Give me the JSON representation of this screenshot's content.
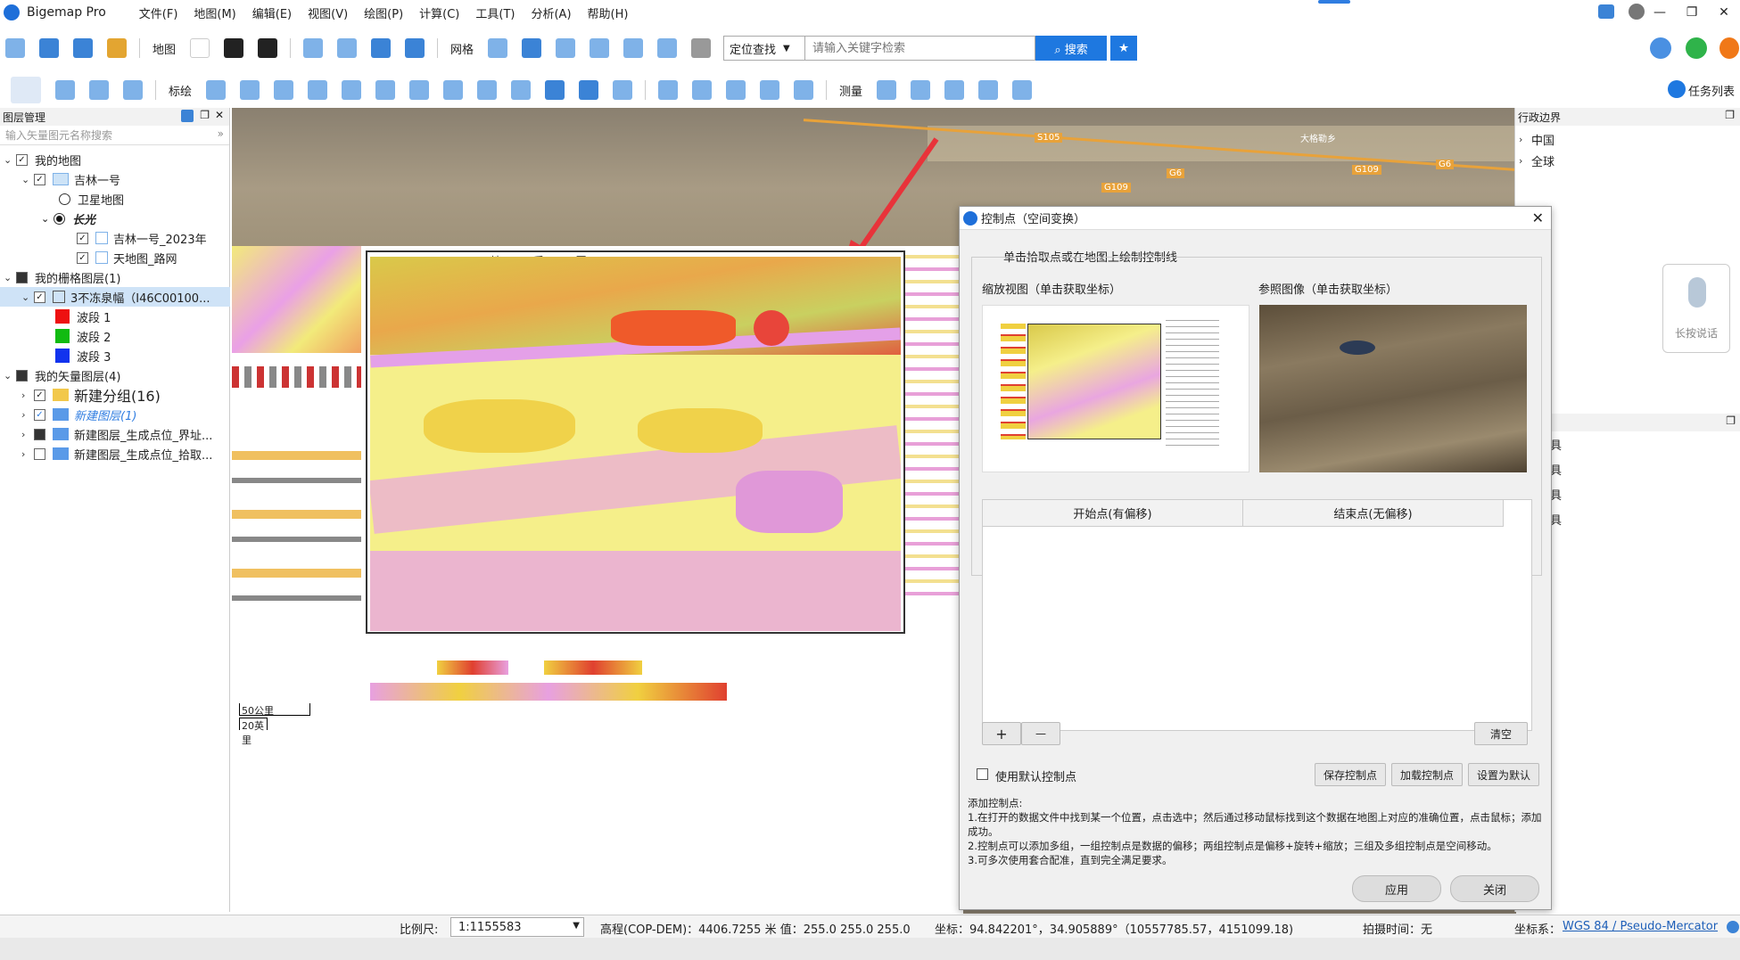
{
  "app": {
    "title": "Bigemap Pro",
    "menus": [
      "文件(F)",
      "地图(M)",
      "编辑(E)",
      "视图(V)",
      "绘图(P)",
      "计算(C)",
      "工具(T)",
      "分析(A)",
      "帮助(H)"
    ],
    "window_controls": [
      "—",
      "❐",
      "✕"
    ]
  },
  "toolbar1": {
    "map_label": "地图",
    "grid_label": "网格",
    "locate_select": "定位查找",
    "search_placeholder": "请输入关键字检索",
    "search_button": "搜索"
  },
  "toolbar2": {
    "mark_label": "标绘",
    "measure_label": "测量",
    "tasklist_label": "任务列表"
  },
  "layer_panel": {
    "title": "图层管理",
    "filter_placeholder": "输入矢量图元名称搜索",
    "my_map": "我的地图",
    "jilin1": "吉林一号",
    "satellite": "卫星地图",
    "changguang": "长光",
    "jilin_2023": "吉林一号_2023年",
    "tianditu": "天地图_路网",
    "raster_layers": "我的栅格图层(1)",
    "raster_item": "3不冻泉幅（I46C00100...",
    "band1": "波段 1",
    "band2": "波段 2",
    "band3": "波段 3",
    "band_colors": [
      "#ee1111",
      "#11bb11",
      "#1133ee"
    ],
    "vector_layers": "我的矢量图层(4)",
    "group": "新建分组(16)",
    "new_layer": "新建图层(1)",
    "gen_layer_1": "新建图层_生成点位_界址...",
    "gen_layer_2": "新建图层_生成点位_拾取..."
  },
  "map": {
    "road_labels": [
      "S105",
      "G6",
      "G109",
      "G109",
      "G6"
    ],
    "place_label": "大格勒乡",
    "sheet_title": "地 质 图",
    "scale_bar_1": "50公里",
    "scale_bar_2": "20英里"
  },
  "right_panel": {
    "admin_title": "行政边界",
    "admin_items": [
      "中国",
      "全球"
    ],
    "tools": [
      "高程工具",
      "矢量工具",
      "栅格工具",
      "其他工具"
    ],
    "voice_label": "长按说话"
  },
  "dialog": {
    "title": "控制点（空间变换）",
    "instruction": "单击拾取点或在地图上绘制控制线",
    "zoom_view_label": "缩放视图（单击获取坐标）",
    "ref_image_label": "参照图像（单击获取坐标）",
    "col_start": "开始点(有偏移)",
    "col_end": "结束点(无偏移)",
    "add_btn": "+",
    "remove_btn": "—",
    "clear_btn": "清空",
    "use_default": "使用默认控制点",
    "save_btn": "保存控制点",
    "load_btn": "加载控制点",
    "set_default_btn": "设置为默认",
    "help_title": "添加控制点:",
    "help_1": "1.在打开的数据文件中找到某一个位置，点击选中；然后通过移动鼠标找到这个数据在地图上对应的准确位置，点击鼠标；添加成功。",
    "help_2": "2.控制点可以添加多组，一组控制点是数据的偏移；两组控制点是偏移+旋转+缩放；三组及多组控制点是空间移动。",
    "help_3": "3.可多次使用套合配准，直到完全满足要求。",
    "apply_btn": "应用",
    "close_btn": "关闭"
  },
  "statusbar": {
    "scale_label": "比例尺:",
    "scale_value": "1:1155583",
    "elevation": "高程(COP-DEM)：4406.7255 米 值：255.0 255.0 255.0",
    "coords": "坐标：94.842201°，34.905889°（10557785.57，4151099.18)",
    "capture_time": "拍摄时间：无",
    "crs_label": "坐标系：",
    "crs_value": "WGS 84 / Pseudo-Mercator"
  }
}
